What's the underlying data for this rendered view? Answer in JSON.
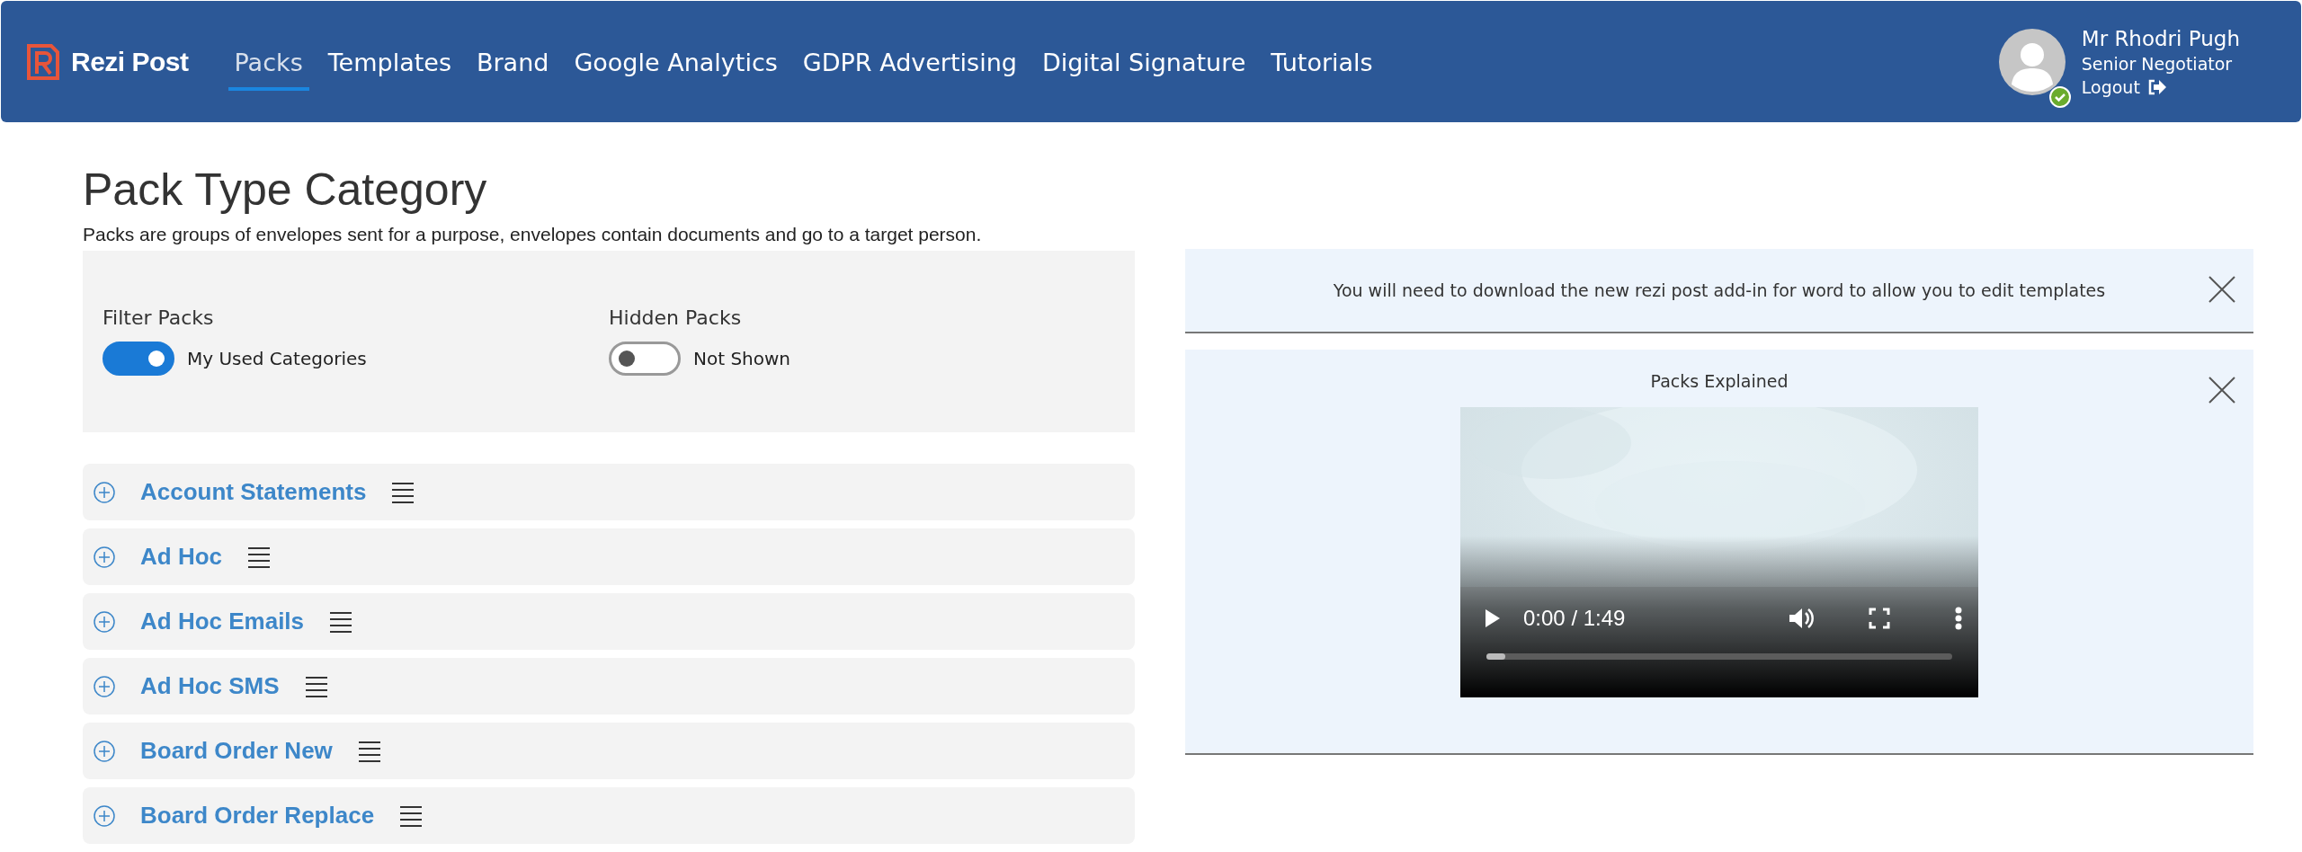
{
  "header": {
    "brand": "Rezi Post",
    "nav": [
      {
        "label": "Packs",
        "selected": true
      },
      {
        "label": "Templates",
        "selected": false
      },
      {
        "label": "Brand",
        "selected": false
      },
      {
        "label": "Google Analytics",
        "selected": false
      },
      {
        "label": "GDPR Advertising",
        "selected": false
      },
      {
        "label": "Digital Signature",
        "selected": false
      },
      {
        "label": "Tutorials",
        "selected": false
      }
    ],
    "user": {
      "name": "Mr Rhodri Pugh",
      "role": "Senior Negotiator",
      "logout": "Logout",
      "online": true
    }
  },
  "page": {
    "title": "Pack Type Category",
    "description": "Packs are groups of envelopes sent for a purpose, envelopes contain documents and go to a target person."
  },
  "filters": [
    {
      "label": "Filter Packs",
      "toggle_text": "My Used Categories",
      "on": true
    },
    {
      "label": "Hidden Packs",
      "toggle_text": "Not Shown",
      "on": false
    }
  ],
  "categories": [
    {
      "name": "Account Statements"
    },
    {
      "name": "Ad Hoc"
    },
    {
      "name": "Ad Hoc Emails"
    },
    {
      "name": "Ad Hoc SMS"
    },
    {
      "name": "Board Order New"
    },
    {
      "name": "Board Order Replace"
    }
  ],
  "notice": {
    "text": "You will need to download the new rezi post add-in for word to allow you to edit templates"
  },
  "video_panel": {
    "title": "Packs Explained",
    "video": {
      "kind": "picture",
      "time": "0:00 / 1:49",
      "progress": {
        "level": 0.04
      }
    }
  }
}
